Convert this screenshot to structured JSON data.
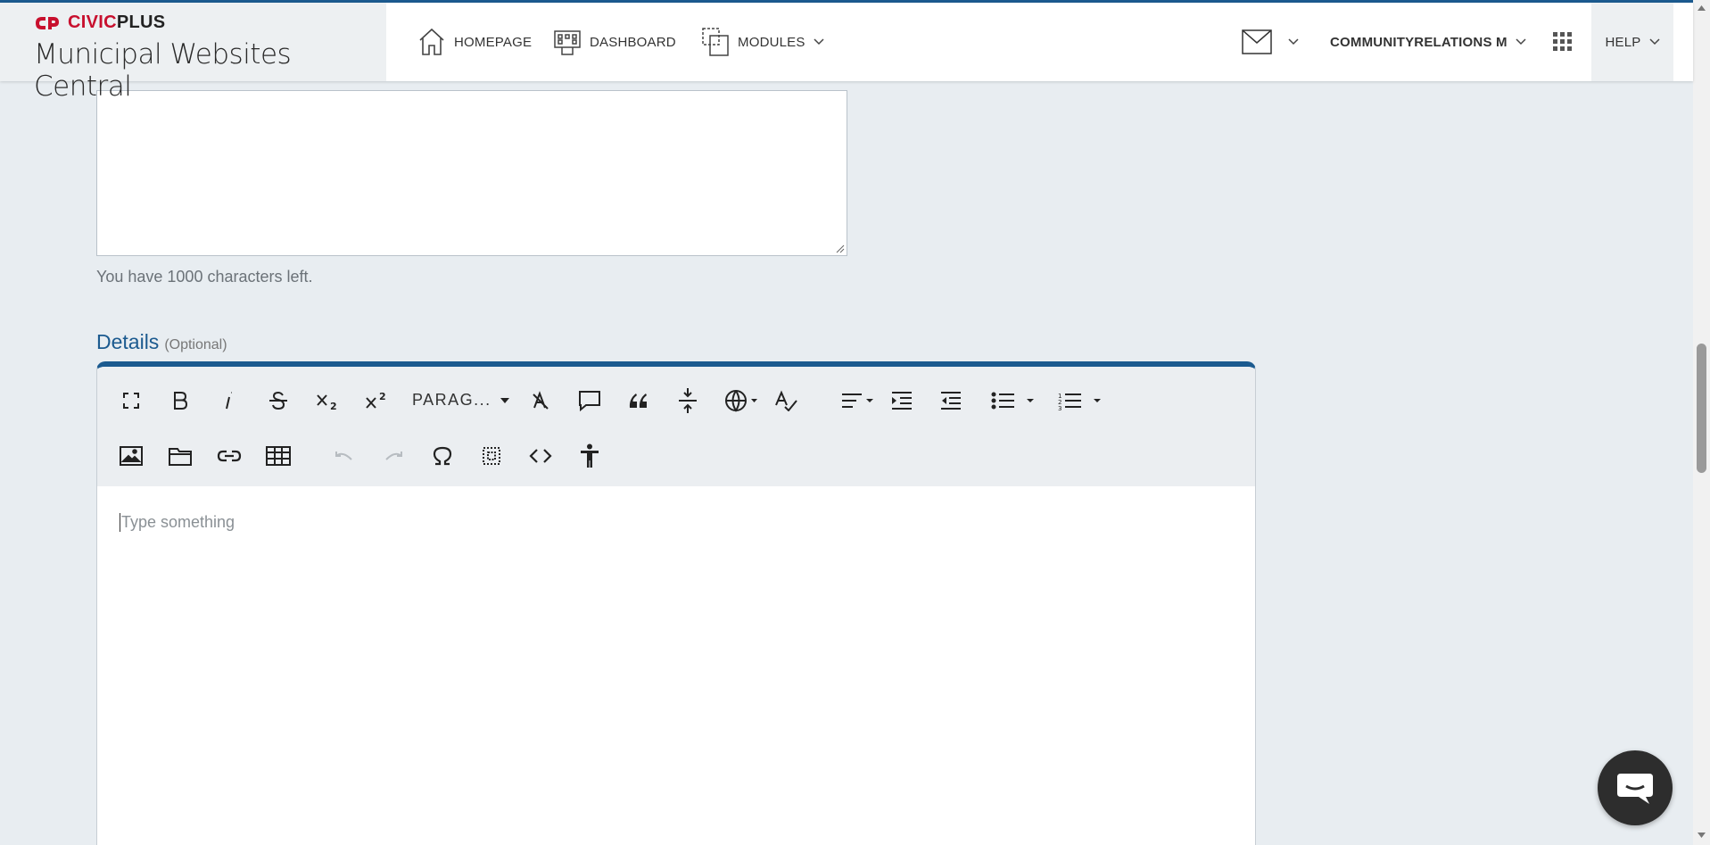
{
  "header": {
    "logo_civic": "CIVIC",
    "logo_plus": "PLUS",
    "site_name": "Municipal Websites Central",
    "nav": {
      "homepage": "HOMEPAGE",
      "dashboard": "DASHBOARD",
      "modules": "MODULES"
    },
    "user_label": "COMMUNITYRELATIONS M",
    "help_label": "HELP"
  },
  "form": {
    "char_count_text": "You have 1000 characters left.",
    "details_title": "Details",
    "details_optional": "(Optional)",
    "paragraph_select": "PARAG...",
    "editor_placeholder": "Type something"
  },
  "colors": {
    "brand_red": "#c8102e",
    "accent_blue": "#1b5a8f",
    "page_bg": "#e8edf1"
  }
}
